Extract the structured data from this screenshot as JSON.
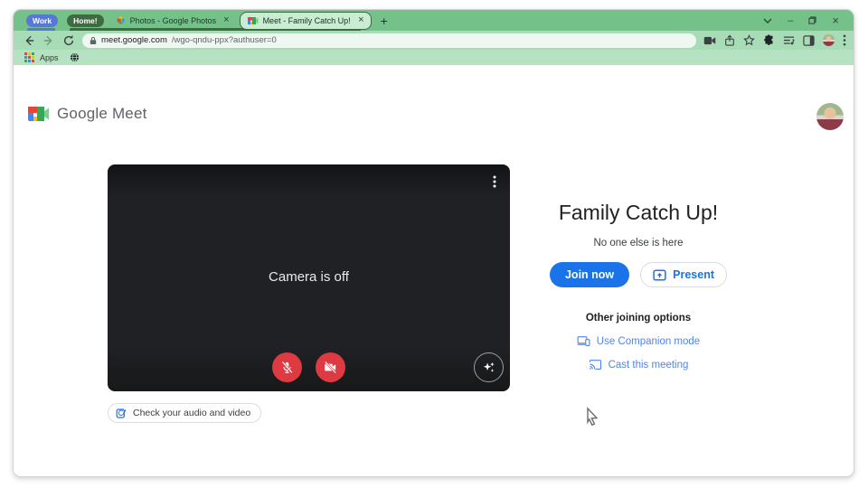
{
  "browser": {
    "tab_groups": [
      {
        "label": "Work",
        "color": "#5878d8"
      },
      {
        "label": "Home!",
        "color": "#3e6b41"
      }
    ],
    "tabs": [
      {
        "title": "Photos - Google Photos",
        "icon": "google-photos",
        "active": false
      },
      {
        "title": "Meet - Family Catch Up!",
        "icon": "google-meet",
        "active": true
      }
    ],
    "new_tab_glyph": "+",
    "window_controls": {
      "minimize": "–",
      "close": "×"
    },
    "tab_close_glyph": "×",
    "toolbar": {
      "url_host": "meet.google.com",
      "url_path": "/wgo-qndu-ppx?authuser=0"
    },
    "bookmarks_bar": {
      "apps_label": "Apps"
    }
  },
  "meet": {
    "logo_text": "Google Meet",
    "preview": {
      "camera_off_label": "Camera is off",
      "check_audio_video_label": "Check your audio and video"
    },
    "join_panel": {
      "title": "Family Catch Up!",
      "presence_text": "No one else is here",
      "join_button_label": "Join now",
      "present_button_label": "Present",
      "other_options_label": "Other joining options",
      "companion_link_label": "Use Companion mode",
      "cast_link_label": "Cast this meeting"
    }
  },
  "colors": {
    "tabstrip_green": "#74c189",
    "toolbar_green": "#a8dcb7",
    "bookmarks_green": "#b5e2c1",
    "active_tab_fill": "#c9ecd3",
    "group_green": "#3e6b41",
    "group_blue": "#5878d8",
    "accent_blue": "#1a73e8",
    "link_blue": "#4e85ea",
    "danger_red": "#dd3b41",
    "preview_bg": "#202124"
  }
}
